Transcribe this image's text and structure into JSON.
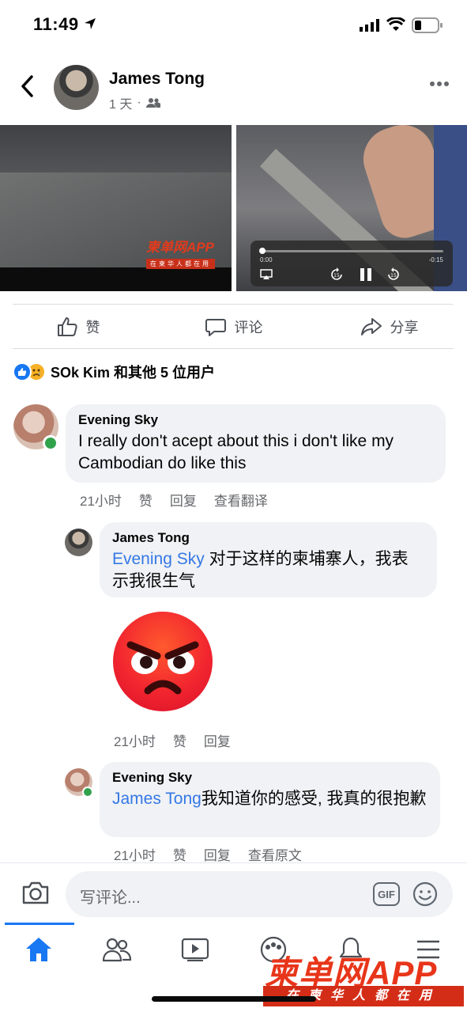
{
  "status_bar": {
    "time": "11:49"
  },
  "post": {
    "author": "James Tong",
    "time_label": "1 天",
    "separator": "·"
  },
  "video_watermark": {
    "brand": "柬单网APP",
    "slogan": "在柬华人都在用"
  },
  "player": {
    "time_start": "0:00",
    "time_end": "-0:15",
    "skip": "15"
  },
  "actions": {
    "like": "赞",
    "comment": "评论",
    "share": "分享"
  },
  "reactions": {
    "summary": "SOk Kim 和其他 5 位用户"
  },
  "comments": [
    {
      "name": "Evening Sky",
      "text": "I really don't acept about this i don't like my Cambodian do like this",
      "time": "21小时",
      "like": "赞",
      "reply": "回复",
      "extra": "查看翻译"
    },
    {
      "name": "James Tong",
      "mention": "Evening Sky",
      "text": " 对于这样的柬埔寨人，我表示我很生气",
      "time": "21小时",
      "like": "赞",
      "reply": "回复"
    },
    {
      "name": "Evening Sky",
      "mention": "James Tong",
      "text": "我知道你的感受, 我真的很抱歉",
      "time": "21小时",
      "like": "赞",
      "reply": "回复",
      "extra": "查看原文"
    }
  ],
  "composer": {
    "placeholder": "写评论...",
    "gif": "GIF"
  },
  "watermark": {
    "brand": "柬单网APP",
    "slogan": "在柬华人都在用"
  },
  "colors": {
    "accent": "#1877f2",
    "online": "#31a24c",
    "brand_red": "#e8351a"
  }
}
